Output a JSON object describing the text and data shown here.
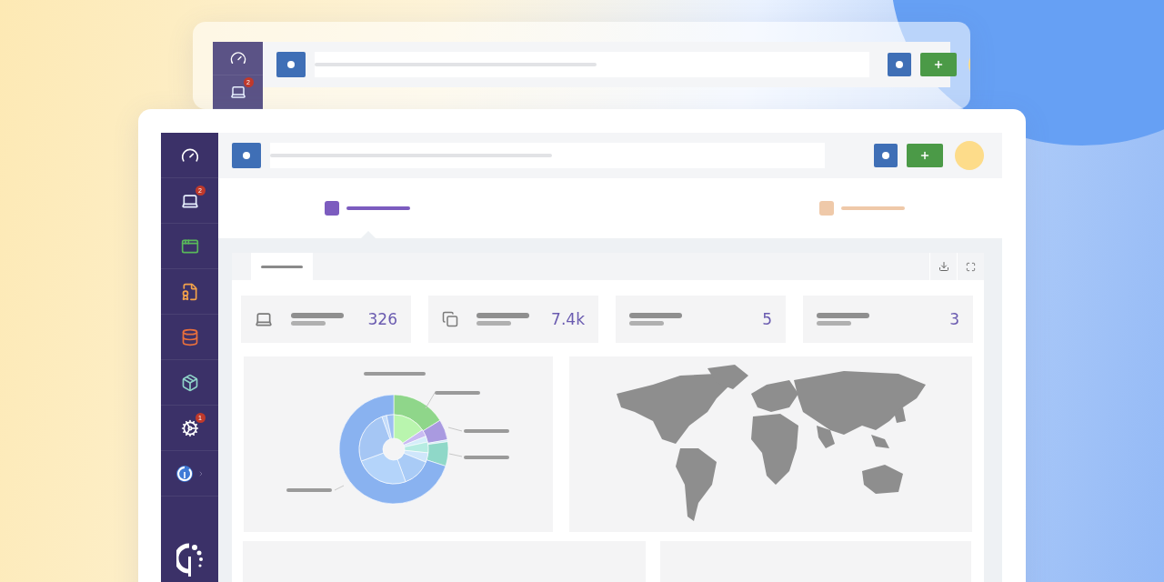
{
  "back_window": {
    "sidebar": {
      "items": [
        {
          "kind": "gauge"
        },
        {
          "kind": "laptop",
          "badge": "2"
        }
      ]
    }
  },
  "sidebar": {
    "items": [
      {
        "kind": "gauge"
      },
      {
        "kind": "laptop",
        "badge": "2"
      },
      {
        "kind": "windows"
      },
      {
        "kind": "certificate"
      },
      {
        "kind": "database"
      },
      {
        "kind": "box"
      },
      {
        "kind": "gears",
        "badge": "1"
      },
      {
        "kind": "logo"
      }
    ]
  },
  "tabs": [
    {
      "color": "#7c5cbf",
      "selected": true
    },
    {
      "color": "#efc9a9",
      "selected": false
    }
  ],
  "stats": [
    {
      "kind": "laptop",
      "value": "326"
    },
    {
      "kind": "copies",
      "value": "7.4k"
    },
    {
      "kind": "plain",
      "value": "5"
    },
    {
      "kind": "plain",
      "value": "3"
    }
  ]
}
